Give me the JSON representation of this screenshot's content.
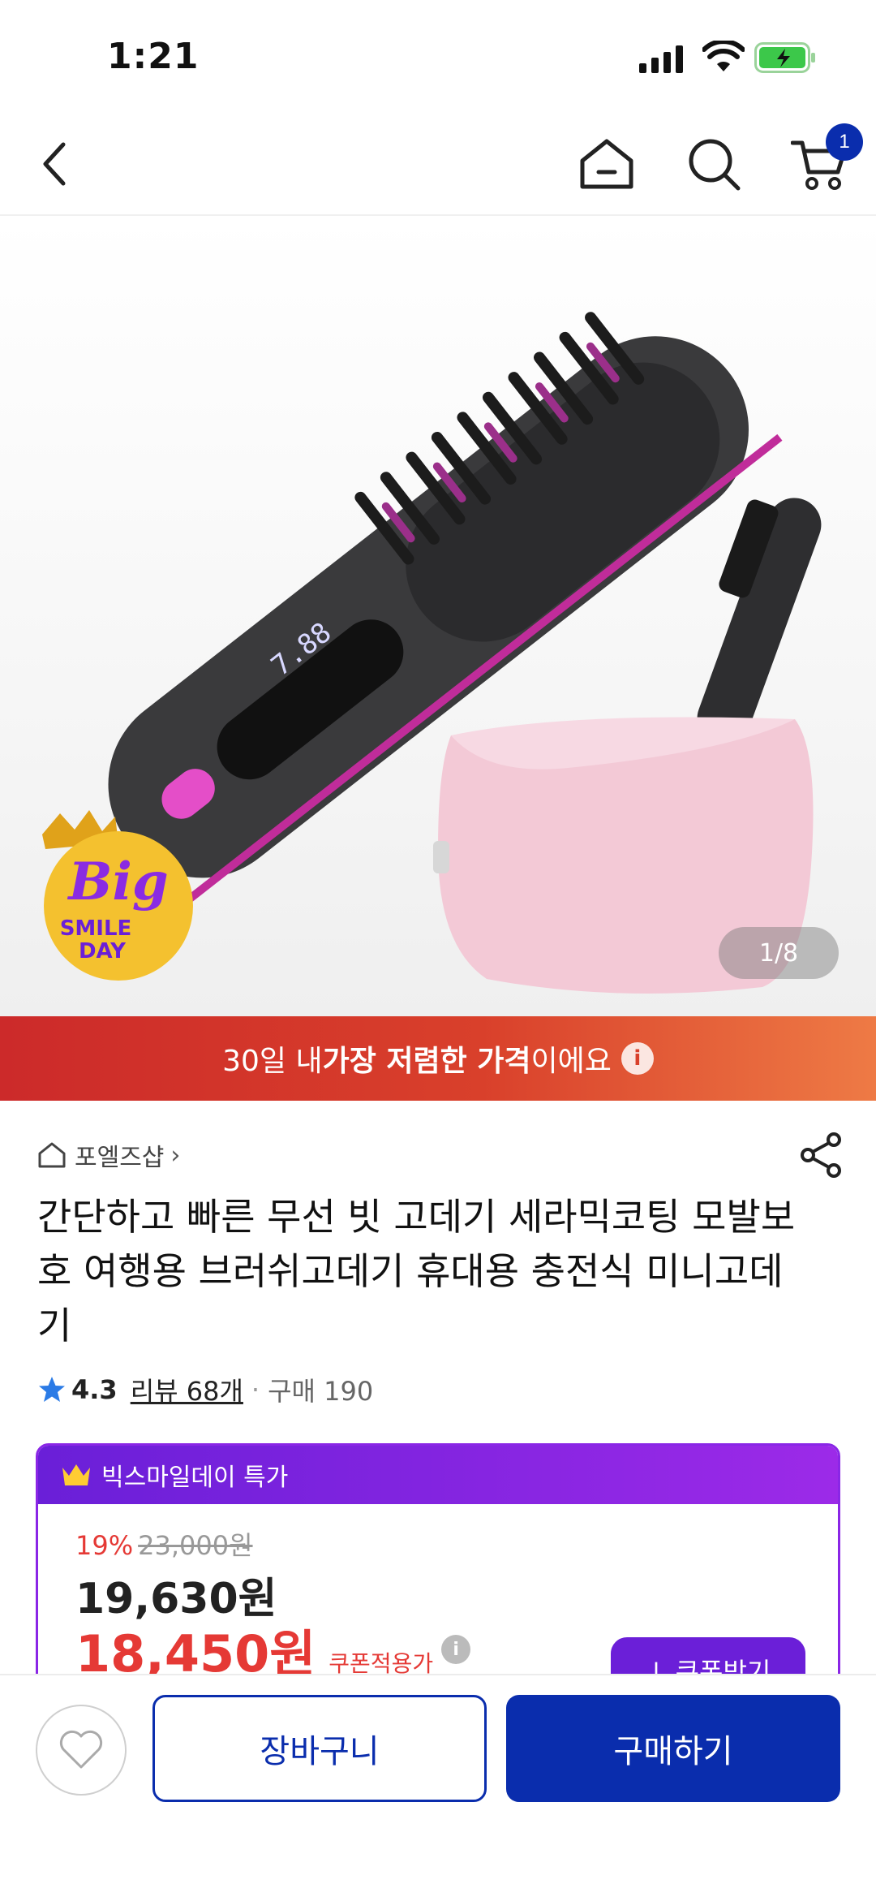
{
  "status_bar": {
    "time": "1:21"
  },
  "nav": {
    "cart_count": "1"
  },
  "product_image": {
    "counter": "1/8",
    "badge_big": "Big",
    "badge_smile": "SMILE",
    "badge_day": "DAY",
    "display_text": "7.88"
  },
  "banner": {
    "prefix": "30일 내 ",
    "strong": "가장 저렴한 가격",
    "suffix": "이에요",
    "info": "i"
  },
  "seller": {
    "name": "포엘즈샵",
    "chevron": "›"
  },
  "product": {
    "title": "간단하고 빠른 무선  빗 고데기 세라믹코팅 모발보호 여행용 브러쉬고데기 휴대용 충전식 미니고데기",
    "rating": "4.3",
    "reviews": "리뷰 68개",
    "separator": "·",
    "purchases": "구매 190"
  },
  "promo": {
    "header": "빅스마일데이 특가",
    "discount_rate": "19%",
    "original_price": "23,000원",
    "sale_price": "19,630원",
    "coupon_price": "18,450원",
    "coupon_label": "쿠폰적용가",
    "coupon_info": "i",
    "coupon_button": "↓ 쿠폰받기"
  },
  "bottom": {
    "cart_label": "장바구니",
    "buy_label": "구매하기"
  },
  "colors": {
    "brand_blue": "#0a2dad",
    "promo_purple": "#8a26e6",
    "price_red": "#e53935",
    "banner_red": "#d9402b"
  }
}
